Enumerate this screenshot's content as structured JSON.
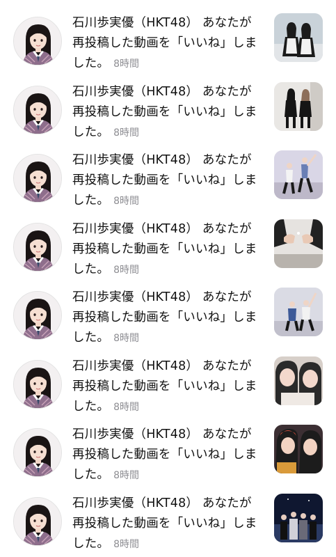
{
  "notifications": [
    {
      "user": "石川歩実優（HKT48）",
      "message": "あなたが再投稿した動画を「いいね」しました。",
      "time": "8時間",
      "thumb_icon": "thumb-maid-duo",
      "palette": [
        "#6d7f8f",
        "#c9d2d9",
        "#1b1b1b",
        "#f2f2f2"
      ]
    },
    {
      "user": "石川歩実優（HKT48）",
      "message": "あなたが再投稿した動画を「いいね」しました。",
      "time": "8時間",
      "thumb_icon": "thumb-black-outfits-duo",
      "palette": [
        "#e9e7e4",
        "#cfcbc6",
        "#151515",
        "#8d6f5a"
      ]
    },
    {
      "user": "石川歩実優（HKT48）",
      "message": "あなたが再投稿した動画を「いいね」しました。",
      "time": "8時間",
      "thumb_icon": "thumb-dance-studio",
      "palette": [
        "#d9d6e6",
        "#bdb8c9",
        "#1a1a1a",
        "#6a7fb5"
      ]
    },
    {
      "user": "石川歩実優（HKT48）",
      "message": "あなたが再投稿した動画を「いいね」しました。",
      "time": "8時間",
      "thumb_icon": "thumb-hands-closeup",
      "palette": [
        "#e6e3e0",
        "#b8b3ad",
        "#222222",
        "#e9c9b5"
      ]
    },
    {
      "user": "石川歩実優（HKT48）",
      "message": "あなたが再投稿した動画を「いいね」しました。",
      "time": "8時間",
      "thumb_icon": "thumb-dance-studio-2",
      "palette": [
        "#dadbe4",
        "#c1c0cc",
        "#161616",
        "#3d5a98"
      ]
    },
    {
      "user": "石川歩実優（HKT48）",
      "message": "あなたが再投稿した動画を「いいね」しました。",
      "time": "8時間",
      "thumb_icon": "thumb-selfie-duo",
      "palette": [
        "#d7cfc9",
        "#efe9e4",
        "#2a2a2a",
        "#f3d8cc"
      ]
    },
    {
      "user": "石川歩実優（HKT48）",
      "message": "あなたが再投稿した動画を「いいね」しました。",
      "time": "8時間",
      "thumb_icon": "thumb-selfie-colorful",
      "palette": [
        "#3c2f33",
        "#d99a3a",
        "#1c1c1c",
        "#c84a3a"
      ]
    },
    {
      "user": "石川歩実優（HKT48）",
      "message": "あなたが再投稿した動画を「いいね」しました。",
      "time": "8時間",
      "thumb_icon": "thumb-night-group",
      "palette": [
        "#0f1730",
        "#2a3a63",
        "#111111",
        "#d0d0d8"
      ]
    }
  ],
  "avatar_icon": "profile-avatar-icon",
  "colors": {
    "text": "#111111",
    "time": "#8e8e93",
    "background": "#ffffff"
  }
}
